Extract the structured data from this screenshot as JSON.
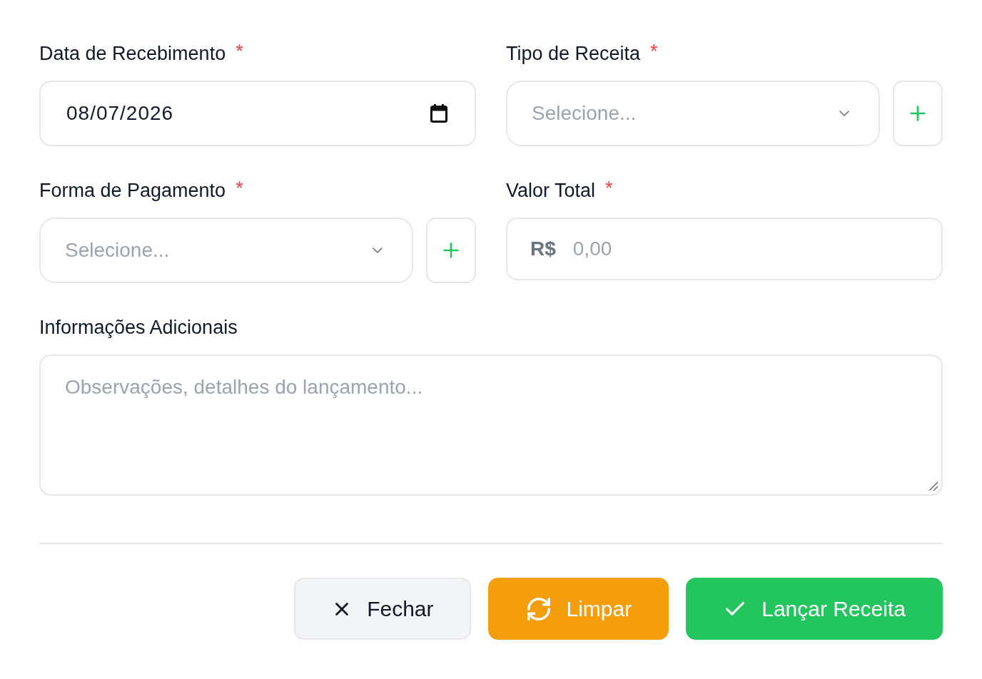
{
  "fields": [
    {
      "kind": "date",
      "label": "Data de Recebimento",
      "required_mark": "*",
      "value": "08/07/2026"
    },
    {
      "kind": "select",
      "label": "Tipo de Receita",
      "required_mark": "*",
      "placeholder": "Selecione...",
      "add_button": true
    },
    {
      "kind": "select",
      "label": "Forma de Pagamento",
      "required_mark": "*",
      "placeholder": "Selecione...",
      "add_button": true
    },
    {
      "kind": "currency",
      "label": "Valor Total",
      "required_mark": "*",
      "prefix": "R$",
      "placeholder": "0,00"
    },
    {
      "kind": "textarea",
      "label": "Informações Adicionais",
      "placeholder": "Observações, detalhes do lançamento..."
    }
  ],
  "buttons": [
    {
      "kind": "close",
      "label": "Fechar"
    },
    {
      "kind": "reset",
      "label": "Limpar"
    },
    {
      "kind": "submit",
      "label": "Lançar Receita"
    }
  ]
}
